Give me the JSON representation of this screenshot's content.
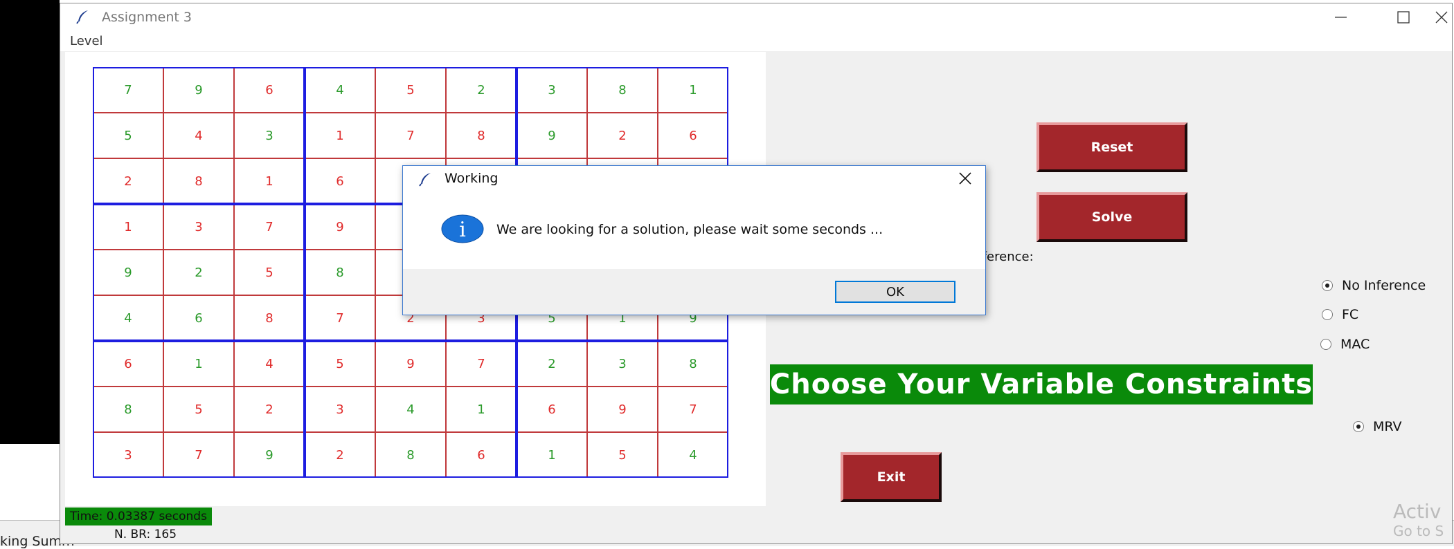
{
  "window": {
    "title": "Assignment 3",
    "menu": [
      "Level"
    ],
    "minimize_icon": "minimize-icon",
    "maximize_icon": "maximize-icon",
    "close_icon": "close-icon"
  },
  "board": {
    "rows": [
      [
        {
          "v": "7",
          "c": "green"
        },
        {
          "v": "9",
          "c": "green"
        },
        {
          "v": "6",
          "c": "red"
        },
        {
          "v": "4",
          "c": "green"
        },
        {
          "v": "5",
          "c": "red"
        },
        {
          "v": "2",
          "c": "green"
        },
        {
          "v": "3",
          "c": "green"
        },
        {
          "v": "8",
          "c": "green"
        },
        {
          "v": "1",
          "c": "green"
        }
      ],
      [
        {
          "v": "5",
          "c": "green"
        },
        {
          "v": "4",
          "c": "red"
        },
        {
          "v": "3",
          "c": "green"
        },
        {
          "v": "1",
          "c": "red"
        },
        {
          "v": "7",
          "c": "red"
        },
        {
          "v": "8",
          "c": "red"
        },
        {
          "v": "9",
          "c": "green"
        },
        {
          "v": "2",
          "c": "red"
        },
        {
          "v": "6",
          "c": "red"
        }
      ],
      [
        {
          "v": "2",
          "c": "red"
        },
        {
          "v": "8",
          "c": "red"
        },
        {
          "v": "1",
          "c": "red"
        },
        {
          "v": "6",
          "c": "red"
        },
        {
          "v": "",
          "c": "red"
        },
        {
          "v": "",
          "c": "red"
        },
        {
          "v": "",
          "c": "red"
        },
        {
          "v": "",
          "c": "red"
        },
        {
          "v": "",
          "c": "red"
        }
      ],
      [
        {
          "v": "1",
          "c": "red"
        },
        {
          "v": "3",
          "c": "red"
        },
        {
          "v": "7",
          "c": "red"
        },
        {
          "v": "9",
          "c": "red"
        },
        {
          "v": "",
          "c": "red"
        },
        {
          "v": "",
          "c": "red"
        },
        {
          "v": "",
          "c": "red"
        },
        {
          "v": "",
          "c": "red"
        },
        {
          "v": "",
          "c": "red"
        }
      ],
      [
        {
          "v": "9",
          "c": "green"
        },
        {
          "v": "2",
          "c": "green"
        },
        {
          "v": "5",
          "c": "red"
        },
        {
          "v": "8",
          "c": "green"
        },
        {
          "v": "",
          "c": "red"
        },
        {
          "v": "",
          "c": "red"
        },
        {
          "v": "",
          "c": "red"
        },
        {
          "v": "",
          "c": "red"
        },
        {
          "v": "",
          "c": "red"
        }
      ],
      [
        {
          "v": "4",
          "c": "green"
        },
        {
          "v": "6",
          "c": "green"
        },
        {
          "v": "8",
          "c": "red"
        },
        {
          "v": "7",
          "c": "red"
        },
        {
          "v": "2",
          "c": "red"
        },
        {
          "v": "3",
          "c": "red"
        },
        {
          "v": "5",
          "c": "green"
        },
        {
          "v": "1",
          "c": "green"
        },
        {
          "v": "9",
          "c": "green"
        }
      ],
      [
        {
          "v": "6",
          "c": "red"
        },
        {
          "v": "1",
          "c": "green"
        },
        {
          "v": "4",
          "c": "red"
        },
        {
          "v": "5",
          "c": "red"
        },
        {
          "v": "9",
          "c": "red"
        },
        {
          "v": "7",
          "c": "red"
        },
        {
          "v": "2",
          "c": "green"
        },
        {
          "v": "3",
          "c": "green"
        },
        {
          "v": "8",
          "c": "green"
        }
      ],
      [
        {
          "v": "8",
          "c": "green"
        },
        {
          "v": "5",
          "c": "red"
        },
        {
          "v": "2",
          "c": "red"
        },
        {
          "v": "3",
          "c": "red"
        },
        {
          "v": "4",
          "c": "green"
        },
        {
          "v": "1",
          "c": "green"
        },
        {
          "v": "6",
          "c": "red"
        },
        {
          "v": "9",
          "c": "red"
        },
        {
          "v": "7",
          "c": "red"
        }
      ],
      [
        {
          "v": "3",
          "c": "red"
        },
        {
          "v": "7",
          "c": "red"
        },
        {
          "v": "9",
          "c": "green"
        },
        {
          "v": "2",
          "c": "red"
        },
        {
          "v": "8",
          "c": "green"
        },
        {
          "v": "6",
          "c": "red"
        },
        {
          "v": "1",
          "c": "green"
        },
        {
          "v": "5",
          "c": "red"
        },
        {
          "v": "4",
          "c": "green"
        }
      ]
    ],
    "colors": {
      "green": "#2a9a2a",
      "red": "#e02b2b",
      "cell_border": "#c0393b",
      "box_border": "#1d1de0"
    }
  },
  "status": {
    "time": "Time: 0.03387 seconds",
    "nbr": "N. BR: 165"
  },
  "buttons": {
    "reset": "Reset",
    "solve": "Solve",
    "exit": "Exit"
  },
  "inference": {
    "label": "Inference:",
    "options": [
      {
        "label": "No Inference",
        "checked": true
      },
      {
        "label": "FC",
        "checked": false
      },
      {
        "label": "MAC",
        "checked": false
      }
    ]
  },
  "variable": {
    "banner": "Choose Your Variable Constraints",
    "options": [
      {
        "label": "MRV",
        "checked": true
      }
    ]
  },
  "dialog": {
    "title": "Working",
    "message": "We are looking for a solution, please wait some seconds ...",
    "ok": "OK",
    "icon": "info-icon"
  },
  "desktop": {
    "watermark_line1": "Activ",
    "watermark_line2": "Go to S",
    "taskbar_fragment": "king Summ"
  },
  "accent_colors": {
    "button_red": "#a3262b",
    "banner_green": "#0a8a0a"
  }
}
